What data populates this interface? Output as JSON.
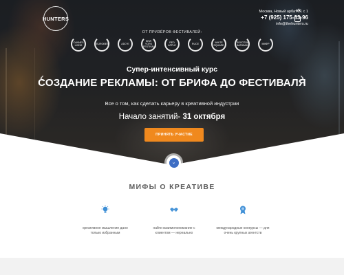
{
  "brand": {
    "logo_text": "HUNTERS"
  },
  "contacts": {
    "address": "Москва, Новый арбат 21 с 1",
    "phone": "+7 (925) 175-33-96",
    "email": "info@thehunters.ru",
    "social": [
      "vk-icon",
      "facebook-icon"
    ]
  },
  "hero": {
    "awards_title": "ОТ ПРИЗЁРОВ ФЕСТИВАЛЕЙ:",
    "awards": [
      "CANNES LIONS",
      "EUROBEST",
      "ADC*E",
      "NEW YORK FESTIVALS",
      "RED APPLE",
      "RUCE",
      "WHITE SQUARE",
      "ЗОЛОТОЙ БАРАБАН",
      "ММФР"
    ],
    "subtitle": "Супер-интенсивный курс",
    "title": "СОЗДАНИЕ РЕКЛАМЫ: ОТ БРИФА ДО ФЕСТИВАЛЯ",
    "description": "Все о том, как сделать карьеру в креативной индустрии",
    "start_label": "Начало занятий-",
    "start_date": "31 октября",
    "cta_label": "ПРИНЯТЬ УЧАСТИЕ",
    "prev_icon": "chevron-left-icon",
    "next_icon": "chevron-right-icon",
    "scroll_icon": "chevron-down-icon"
  },
  "myths": {
    "title": "МИФЫ О КРЕАТИВЕ",
    "items": [
      {
        "icon": "lightbulb-icon",
        "line1": "креативное мышление дано",
        "line2": "только избранным"
      },
      {
        "icon": "handshake-icon",
        "line1": "найти взаимопонимание с",
        "line2": "клиентом — нереально"
      },
      {
        "icon": "award-medal-icon",
        "line1": "международные конкурсы — для",
        "line2": "очень крупных агентств"
      }
    ]
  },
  "colors": {
    "accent_orange": "#f0891e",
    "icon_blue": "#3e8fd6",
    "scroll_blue": "#3e6ec4",
    "section_title": "#5c5c5c"
  }
}
